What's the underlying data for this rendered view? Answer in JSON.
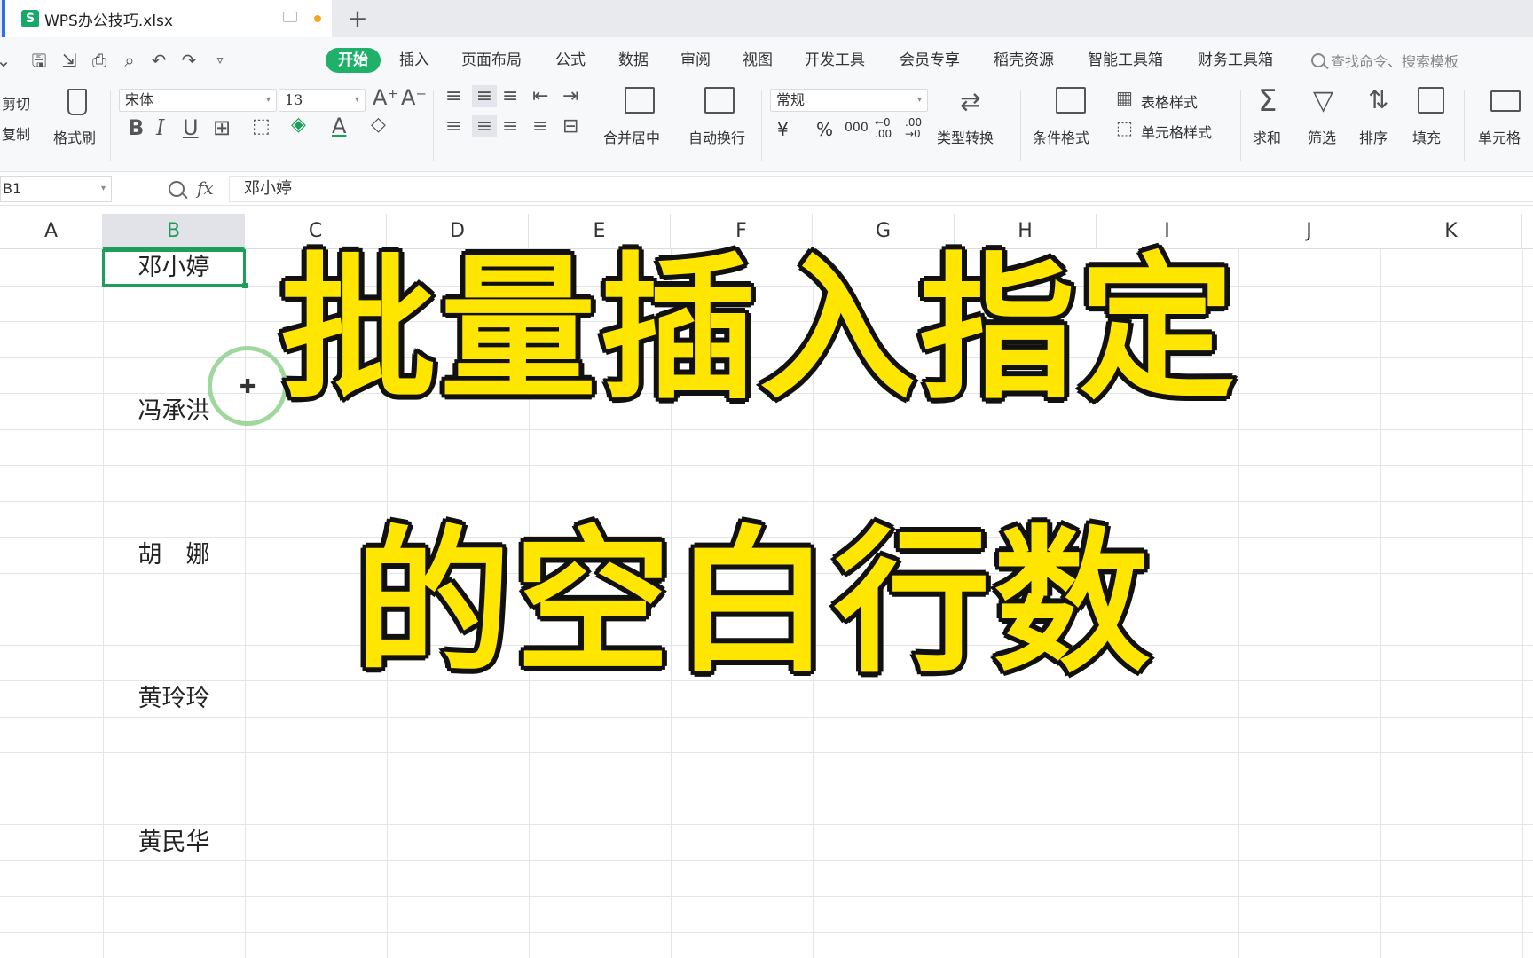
{
  "titlebar": {
    "file_name": "WPS办公技巧.xlsx",
    "file_icon_letter": "S",
    "new_tab": "+"
  },
  "menu": {
    "start": "开始",
    "items": [
      "插入",
      "页面布局",
      "公式",
      "数据",
      "审阅",
      "视图",
      "开发工具",
      "会员专享",
      "稻壳资源",
      "智能工具箱",
      "财务工具箱"
    ],
    "search_placeholder": "查找命令、搜索模板"
  },
  "ribbon": {
    "cut": "剪切",
    "copy": "复制",
    "format_painter": "格式刷",
    "font_name": "宋体",
    "font_size": "13",
    "merge_center": "合并居中",
    "wrap_text": "自动换行",
    "number_format": "常规",
    "currency": "¥",
    "percent": "%",
    "thousands": "000",
    "inc_decimal": "←0\n.00",
    "dec_decimal": ".00\n→0",
    "type_convert": "类型转换",
    "conditional_format": "条件格式",
    "table_style": "表格样式",
    "cell_style": "单元格样式",
    "sum": "求和",
    "filter": "筛选",
    "sort": "排序",
    "fill": "填充",
    "cell": "单元格"
  },
  "formula_bar": {
    "cell_ref": "B1",
    "fx": "fx",
    "content": "邓小婷"
  },
  "columns": [
    "A",
    "B",
    "C",
    "D",
    "E",
    "F",
    "G",
    "H",
    "I",
    "J",
    "K"
  ],
  "selected_column": "B",
  "cells": [
    {
      "ref": "B1",
      "value": "邓小婷"
    },
    {
      "ref": "B5",
      "value": "冯承洪"
    },
    {
      "ref": "B9",
      "value": "胡　娜"
    },
    {
      "ref": "B13",
      "value": "黄玲玲"
    },
    {
      "ref": "B17",
      "value": "黄民华"
    }
  ],
  "overlay": {
    "line1": "批量插入指定",
    "line2": "的空白行数"
  },
  "colors": {
    "accent_green": "#1fb16a",
    "headline_yellow": "#ffe600",
    "headline_outline": "#111111"
  }
}
